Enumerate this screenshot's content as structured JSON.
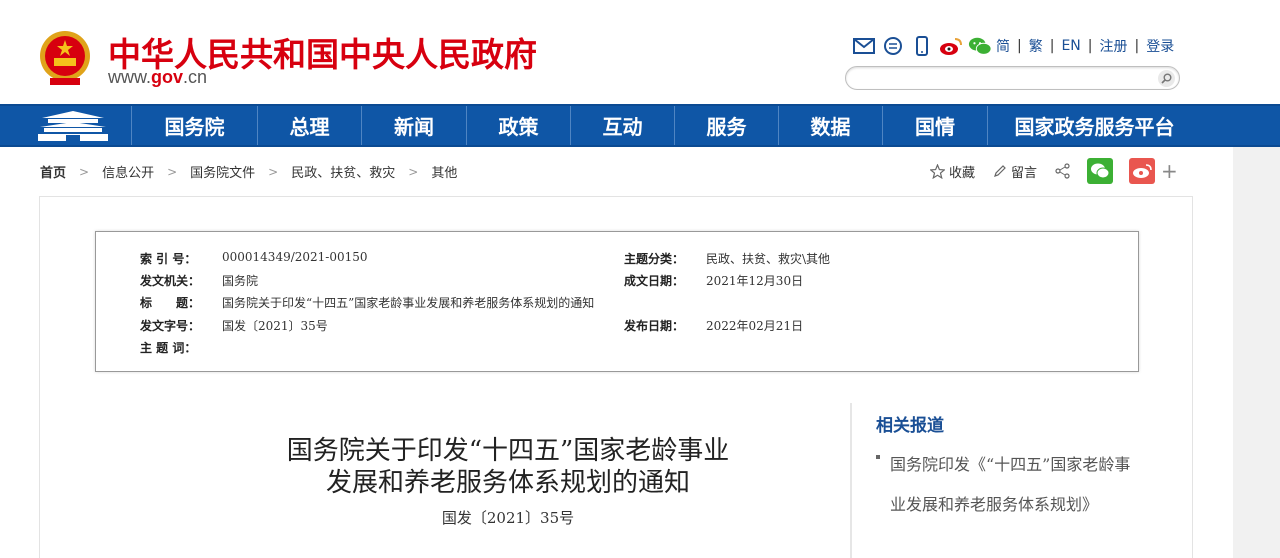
{
  "header": {
    "site_title": "中华人民共和国中央人民政府",
    "site_url_prefix": "www.",
    "site_url_gov": "gov",
    "site_url_suffix": ".cn",
    "lang_links": [
      "简",
      "繁",
      "EN",
      "注册",
      "登录"
    ],
    "icons": [
      "mail-icon",
      "message-icon",
      "mobile-icon",
      "weibo-icon",
      "wechat-icon"
    ],
    "search_placeholder": ""
  },
  "nav": {
    "items": [
      "国务院",
      "总理",
      "新闻",
      "政策",
      "互动",
      "服务",
      "数据",
      "国情",
      "国家政务服务平台"
    ]
  },
  "breadcrumb": {
    "items": [
      "首页",
      "信息公开",
      "国务院文件",
      "民政、扶贫、救灾",
      "其他"
    ]
  },
  "share": {
    "favorite": "收藏",
    "comment": "留言"
  },
  "info": {
    "index_label": "索 引 号：",
    "index_value": "000014349/2021-00150",
    "topic_label": "主题分类：",
    "topic_value": "民政、扶贫、救灾\\其他",
    "issuer_label": "发文机关：",
    "issuer_value": "国务院",
    "date_written_label": "成文日期：",
    "date_written_value": "2021年12月30日",
    "title_label": "标　　题：",
    "title_value": "国务院关于印发“十四五”国家老龄事业发展和养老服务体系规划的通知",
    "doc_number_label": "发文字号：",
    "doc_number_value": "国发〔2021〕35号",
    "publish_date_label": "发布日期：",
    "publish_date_value": "2022年02月21日",
    "keywords_label": "主 题 词："
  },
  "document": {
    "title_line1": "国务院关于印发“十四五”国家老龄事业",
    "title_line2": "发展和养老服务体系规划的通知",
    "number": "国发〔2021〕35号"
  },
  "related": {
    "heading": "相关报道",
    "link1": "国务院印发《“十四五”国家老龄事业发展和养老服务体系规划》"
  },
  "colors": {
    "brand_red": "#d7000f",
    "nav_blue": "#0f56a6",
    "link_blue": "#1a4f95"
  }
}
